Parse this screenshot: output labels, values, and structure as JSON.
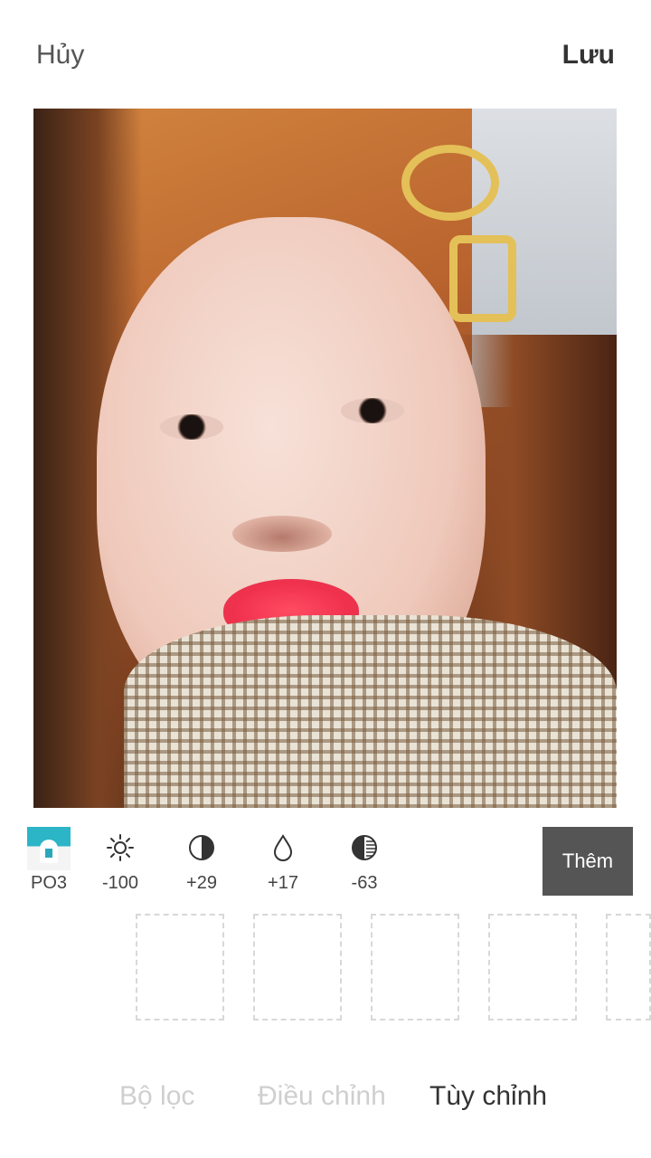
{
  "header": {
    "cancel_label": "Hủy",
    "save_label": "Lưu"
  },
  "photo": {
    "description_icon": "portrait-photo"
  },
  "toolbar": {
    "preset": {
      "label": "PO3",
      "icon": "preset-thumbnail"
    },
    "tools": [
      {
        "icon": "brightness-icon",
        "value": "-100"
      },
      {
        "icon": "contrast-icon",
        "value": "+29"
      },
      {
        "icon": "saturation-drop-icon",
        "value": "+17"
      },
      {
        "icon": "exposure-icon",
        "value": "-63"
      }
    ],
    "more_label": "Thêm"
  },
  "slots": {
    "count": 5
  },
  "tabs": [
    {
      "label": "Bộ lọc",
      "active": false
    },
    {
      "label": "Điều chỉnh",
      "active": false
    },
    {
      "label": "Tùy chỉnh",
      "active": true
    }
  ],
  "colors": {
    "accent_dark": "#555555",
    "inactive_tab": "#cfcfcf",
    "active_tab": "#333333"
  }
}
